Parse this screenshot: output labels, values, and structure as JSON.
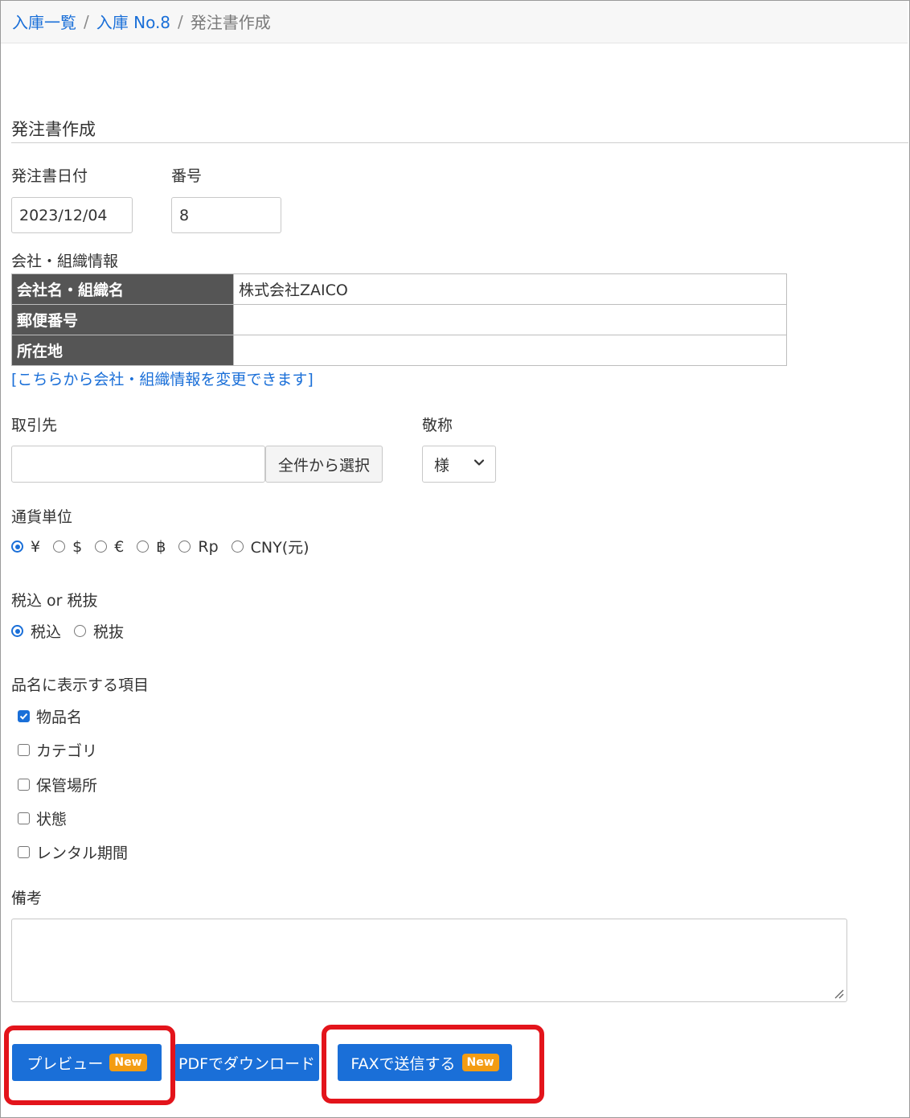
{
  "breadcrumb": {
    "items": [
      "入庫一覧",
      "入庫 No.8"
    ],
    "separator": "/",
    "current": "発注書作成"
  },
  "section_title": "発注書作成",
  "order_date": {
    "label": "発注書日付",
    "value": "2023/12/04"
  },
  "order_number": {
    "label": "番号",
    "value": "8"
  },
  "company": {
    "label": "会社・組織情報",
    "rows": [
      {
        "header": "会社名・組織名",
        "value": "株式会社ZAICO"
      },
      {
        "header": "郵便番号",
        "value": ""
      },
      {
        "header": "所在地",
        "value": ""
      }
    ],
    "change_link": "[こちらから会社・組織情報を変更できます]"
  },
  "supplier": {
    "label": "取引先",
    "value": "",
    "select_button": "全件から選択"
  },
  "honorific": {
    "label": "敬称",
    "selected": "様"
  },
  "currency": {
    "label": "通貨単位",
    "options": [
      "¥",
      "$",
      "€",
      "฿",
      "Rp",
      "CNY(元)"
    ],
    "selected": "¥"
  },
  "tax": {
    "label": "税込 or 税抜",
    "options": [
      "税込",
      "税抜"
    ],
    "selected": "税込"
  },
  "item_fields": {
    "label": "品名に表示する項目",
    "options": [
      {
        "label": "物品名",
        "checked": true
      },
      {
        "label": "カテゴリ",
        "checked": false
      },
      {
        "label": "保管場所",
        "checked": false
      },
      {
        "label": "状態",
        "checked": false
      },
      {
        "label": "レンタル期間",
        "checked": false
      }
    ]
  },
  "notes": {
    "label": "備考",
    "value": ""
  },
  "actions": {
    "preview": "プレビュー",
    "pdf_download": "PDFでダウンロード",
    "fax_send": "FAXで送信する",
    "new_badge": "New"
  },
  "colors": {
    "primary": "#1a6fd8",
    "badge": "#f39c12",
    "highlight": "#e3141b",
    "table_header": "#555555"
  }
}
